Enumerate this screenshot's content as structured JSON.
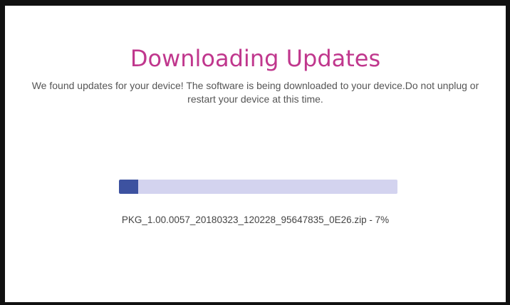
{
  "dialog": {
    "title": "Downloading Updates",
    "message": "We found updates for your device! The software is being downloaded to your device.Do not unplug or restart your device at this time.",
    "progress": {
      "percent": 7,
      "fill_color": "#3d52a0",
      "track_color": "#d3d3ef"
    },
    "status_text": "PKG_1.00.0057_20180323_120228_95647835_0E26.zip - 7%"
  },
  "colors": {
    "title": "#c0378d",
    "text": "#555555",
    "border": "#111111"
  }
}
